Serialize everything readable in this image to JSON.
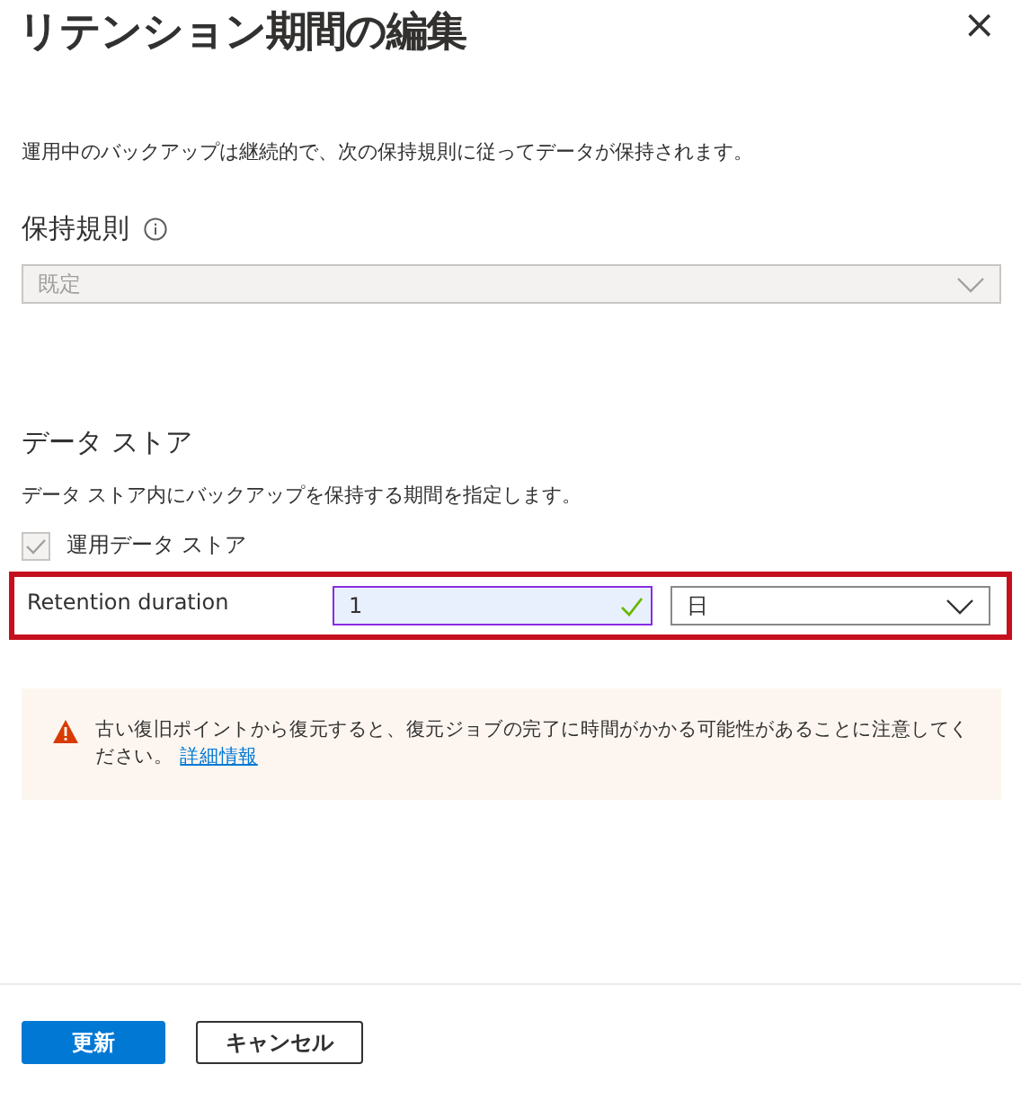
{
  "panel": {
    "title": "リテンション期間の編集",
    "close": "×"
  },
  "description": "運用中のバックアップは継続的で、次の保持規則に従ってデータが保持されます。",
  "retention_rule": {
    "label": "保持規則",
    "value": "既定",
    "disabled": true
  },
  "data_store": {
    "heading": "データ ストア",
    "description": "データ ストア内にバックアップを保持する期間を指定します。",
    "checkbox": {
      "label": "運用データ ストア",
      "checked": true,
      "disabled": true
    },
    "duration": {
      "label": "Retention duration",
      "value": "1",
      "valid": true,
      "unit": "日",
      "highlighted": true
    }
  },
  "warning": {
    "text": "古い復旧ポイントから復元すると、復元ジョブの完了に時間がかかる可能性があることに注意してください。",
    "link": "詳細情報"
  },
  "buttons": [
    {
      "label": "更新",
      "kind": "primary"
    },
    {
      "label": "キャンセル",
      "kind": "secondary"
    }
  ]
}
